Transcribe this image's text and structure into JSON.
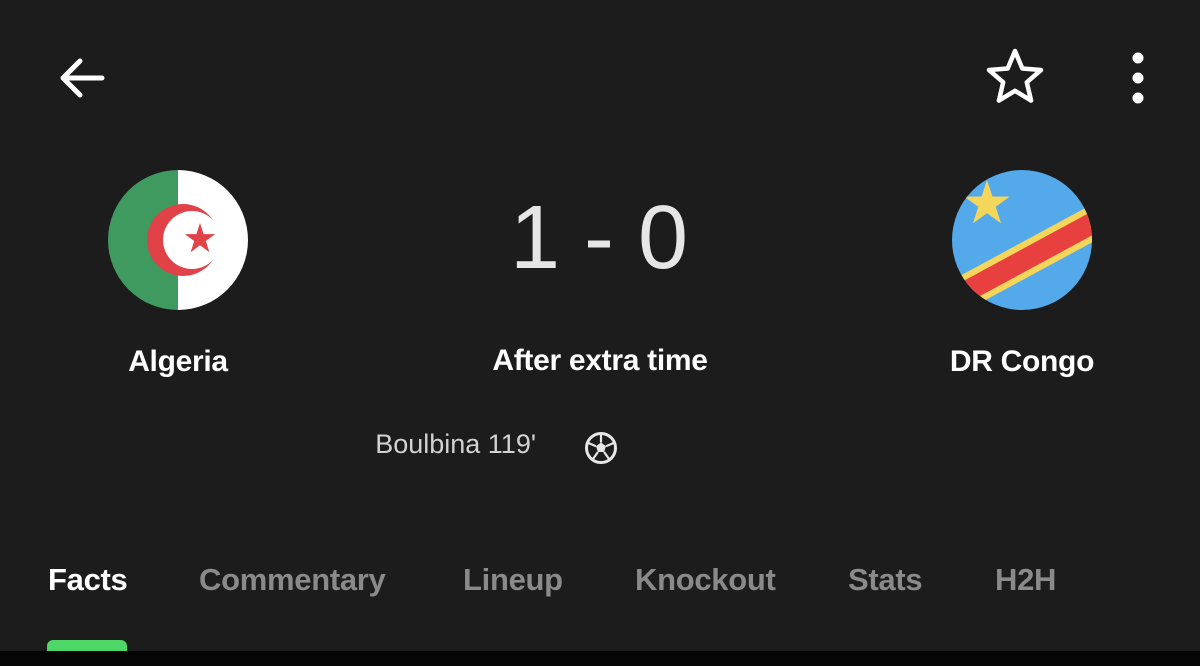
{
  "header": {
    "back_icon": "arrow-left-icon",
    "favorite_icon": "star-outline-icon",
    "more_icon": "more-vertical-icon"
  },
  "match": {
    "home_team": {
      "name": "Algeria",
      "flag_icon": "algeria-flag-icon"
    },
    "away_team": {
      "name": "DR Congo",
      "flag_icon": "dr-congo-flag-icon"
    },
    "home_score": "1",
    "separator": "-",
    "away_score": "0",
    "status": "After extra time",
    "goals": [
      {
        "scorer_text": "Boulbina 119'",
        "icon": "soccer-ball-icon"
      }
    ]
  },
  "tabs": [
    {
      "label": "Facts",
      "active": true
    },
    {
      "label": "Commentary",
      "active": false
    },
    {
      "label": "Lineup",
      "active": false
    },
    {
      "label": "Knockout",
      "active": false
    },
    {
      "label": "Stats",
      "active": false
    },
    {
      "label": "H2H",
      "active": false
    }
  ],
  "colors": {
    "background": "#1c1c1c",
    "active_tab_indicator": "#4ed868",
    "inactive_tab": "#8a8a8a",
    "algeria_green": "#3f9a5f",
    "algeria_red": "#e04247",
    "congo_blue": "#54a9ea",
    "congo_red": "#e8403f",
    "congo_yellow": "#f4d65a"
  }
}
